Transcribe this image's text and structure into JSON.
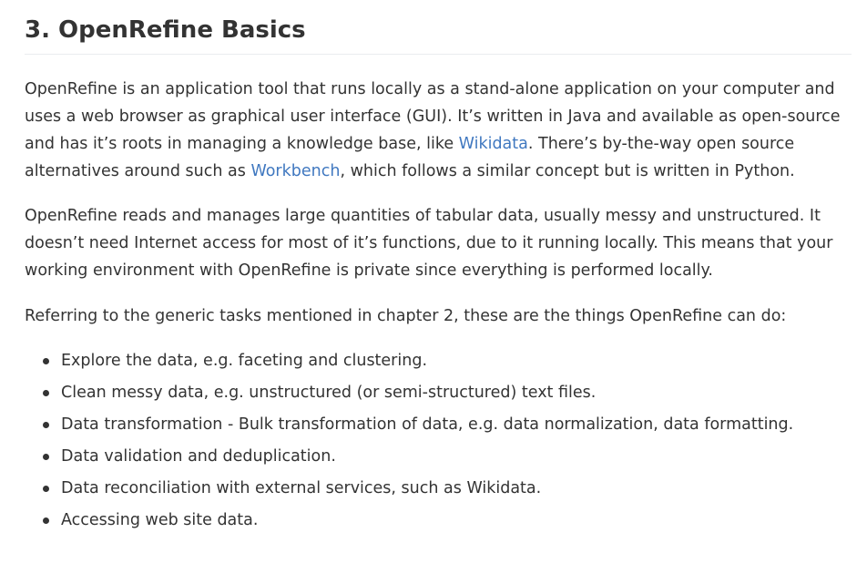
{
  "heading": "3. OpenRefine Basics",
  "para1": {
    "text_1": "OpenRefine is an application tool that runs locally as a stand-alone application on your computer and uses a web browser as graphical user interface (GUI). It’s written in Java and available as open-source and has it’s roots in managing a knowledge base, like ",
    "link_wikidata": "Wikidata",
    "text_2": ". There’s by-the-way open source alternatives around such as ",
    "link_workbench": "Workbench",
    "text_3": ", which follows a similar concept but is written in Python."
  },
  "para2": "OpenRefine reads and manages large quantities of tabular data, usually messy and unstructured. It doesn’t need Internet access for most of it’s functions, due to it running locally. This means that your working environment with OpenRefine is private since everything is performed locally.",
  "para3": "Referring to the generic tasks mentioned in chapter 2, these are the things OpenRefine can do:",
  "tasks": [
    "Explore the data, e.g. faceting and clustering.",
    "Clean messy data, e.g. unstructured (or semi-structured) text files.",
    "Data transformation - Bulk transformation of data, e.g. data normalization, data formatting.",
    "Data validation and deduplication.",
    "Data reconciliation with external services, such as Wikidata.",
    "Accessing web site data."
  ],
  "colors": {
    "text": "#333333",
    "link": "#4078c0",
    "rule": "#eaecef"
  }
}
